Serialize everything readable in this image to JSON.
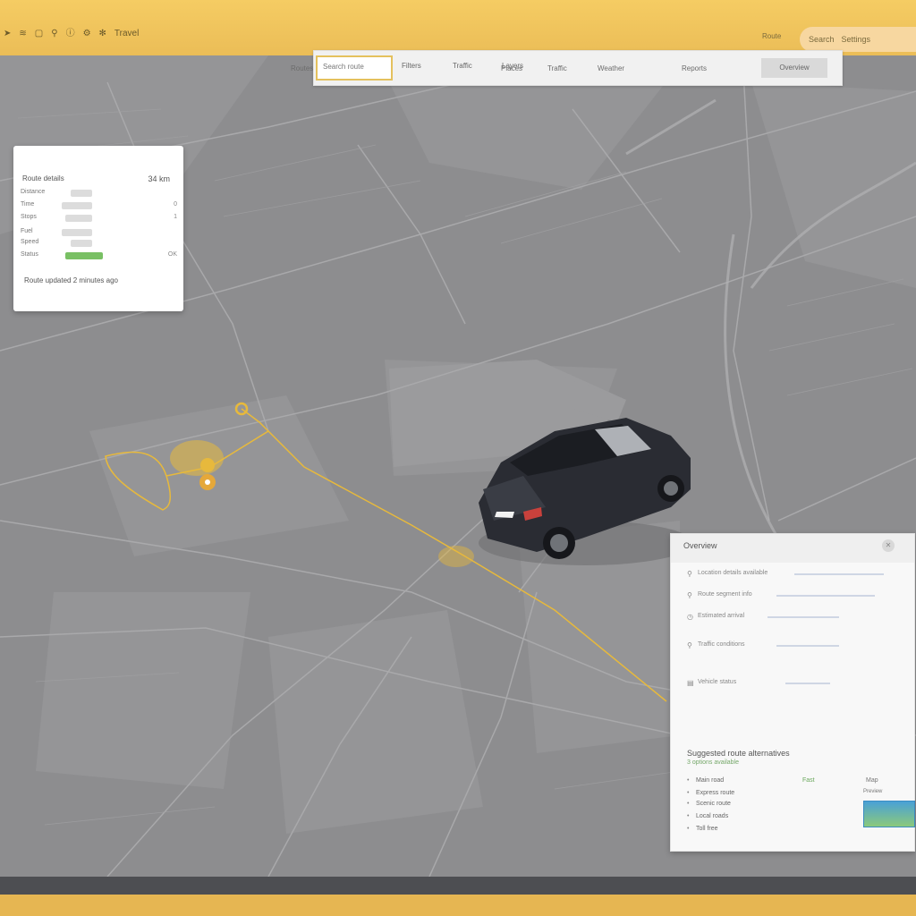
{
  "topbar": {
    "icons": [
      "arrow-icon",
      "layers-icon",
      "bookmark-icon",
      "pin-icon",
      "info-icon",
      "gear-icon",
      "settings-icon"
    ],
    "app_label": "Travel",
    "right_label_1": "Search",
    "right_label_2": "Settings",
    "mid_label": "Route"
  },
  "toolbar": {
    "search_placeholder": "Search route",
    "tab_1": "Filters",
    "tab_2": "Traffic",
    "tab_3": "Layers",
    "button_label": "Overview",
    "subtabs": [
      "Routes",
      "Places",
      "Traffic",
      "Weather",
      "Reports"
    ]
  },
  "panel_left": {
    "title": "Route details",
    "value": "34 km",
    "rows": [
      {
        "label": "Distance",
        "value": ""
      },
      {
        "label": "Time",
        "value": "0"
      },
      {
        "label": "Stops",
        "value": "1"
      },
      {
        "label": "Fuel",
        "value": ""
      },
      {
        "label": "Speed",
        "value": ""
      },
      {
        "label": "Status",
        "value": "OK"
      }
    ],
    "footer": "Route updated 2 minutes ago"
  },
  "panel_right": {
    "title": "Overview",
    "rows": [
      "Location details available",
      "Route segment info",
      "Estimated arrival",
      "Traffic conditions",
      "Vehicle status"
    ],
    "section_title": "Suggested route alternatives",
    "section_sub": "3 options available",
    "green_label": "Fast",
    "small_label": "Map",
    "thumb_label": "Preview",
    "list": [
      "Main road",
      "Express route",
      "Scenic route",
      "Local roads",
      "Toll free"
    ]
  },
  "colors": {
    "frame": "#e8bb58",
    "map": "#8d8d8f",
    "route": "#e7b93c",
    "panel": "#ffffff",
    "accent_green": "#79c064"
  }
}
